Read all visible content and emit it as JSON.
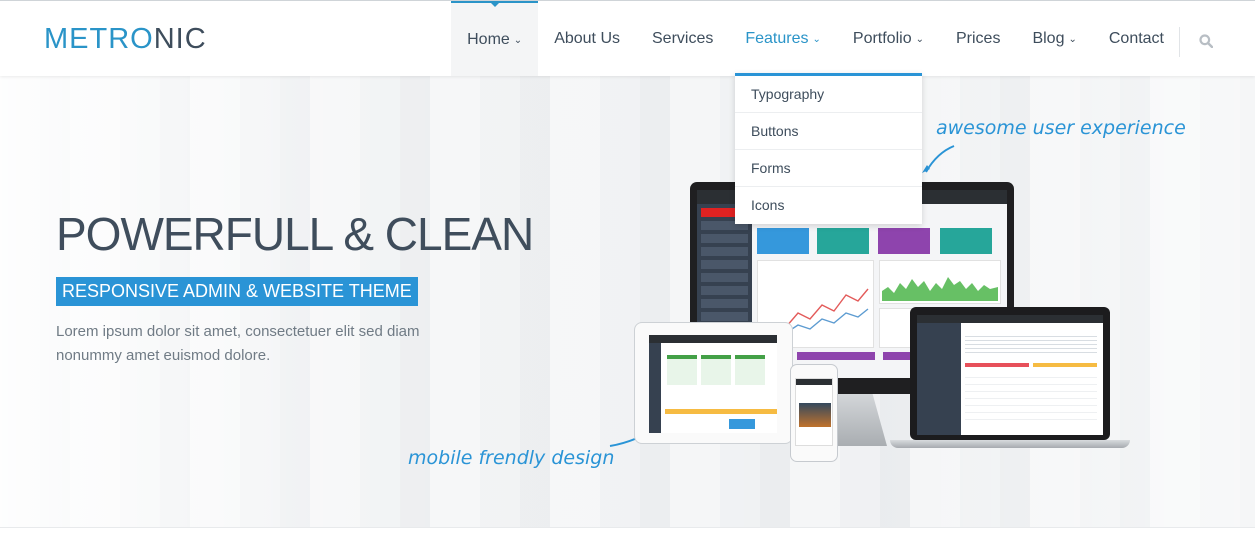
{
  "brand": {
    "part1": "METRO",
    "part2": "NIC"
  },
  "nav": {
    "home": "Home",
    "about": "About Us",
    "services": "Services",
    "features": "Features",
    "portfolio": "Portfolio",
    "prices": "Prices",
    "blog": "Blog",
    "contact": "Contact"
  },
  "features_menu": {
    "items": [
      "Typography",
      "Buttons",
      "Forms",
      "Icons"
    ]
  },
  "hero": {
    "title": "POWERFULL & CLEAN",
    "badge": "RESPONSIVE ADMIN & WEBSITE THEME",
    "lead_line1": "Lorem ipsum dolor sit amet, consectetuer elit sed diam",
    "lead_line2": "nonummy amet euismod dolore.",
    "callout_top": "awesome user experience",
    "callout_bottom": "mobile frendly design"
  },
  "colors": {
    "accent": "#2a94d6",
    "text": "#3e4d5c",
    "tile_blue": "#3598dc",
    "tile_green": "#26a69a",
    "tile_purple": "#8e44ad",
    "tile_red": "#e7505a"
  },
  "icons": [
    "search-icon",
    "chevron-down-icon",
    "arrow-icon"
  ]
}
